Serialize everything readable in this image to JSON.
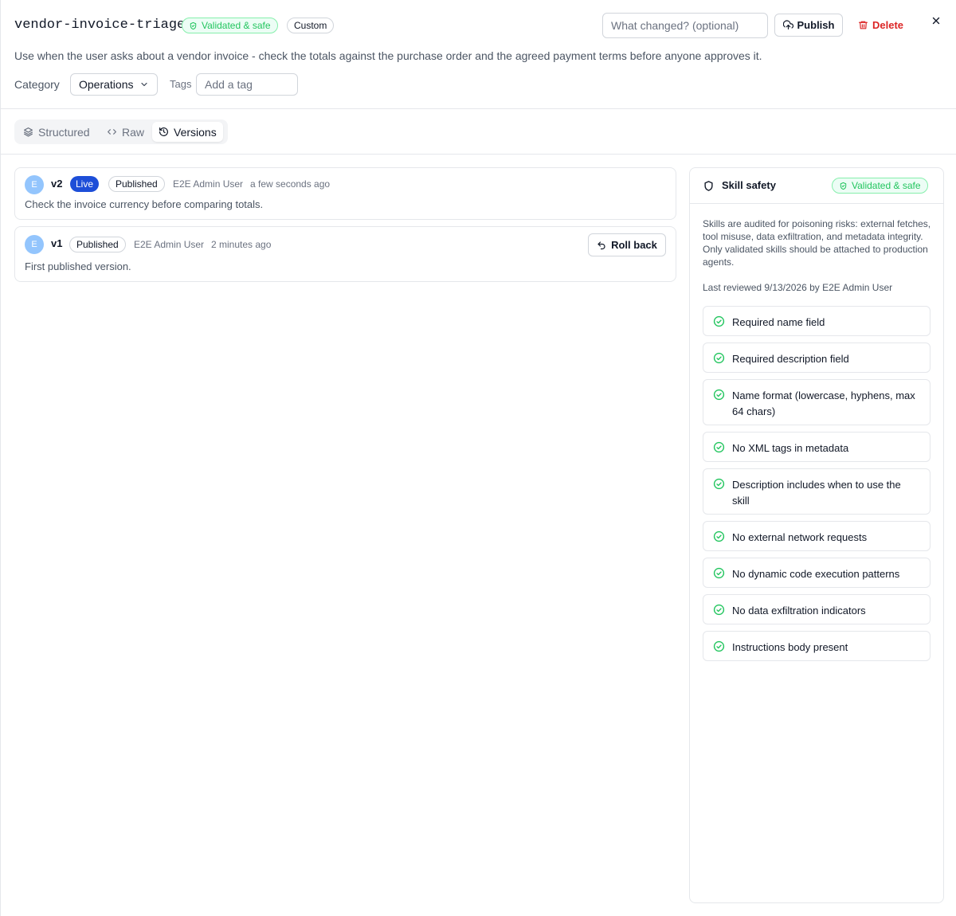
{
  "header": {
    "title": "vendor-invoice-triage",
    "status_badge": "Validated & safe",
    "type_badge": "Custom",
    "change_placeholder": "What changed? (optional)",
    "publish_label": "Publish",
    "delete_label": "Delete",
    "description": "Use when the user asks about a vendor invoice - check the totals against the purchase order and the agreed payment terms before anyone approves it.",
    "category_label": "Category",
    "category_value": "Operations",
    "tags_label": "Tags",
    "tags_placeholder": "Add a tag"
  },
  "tabs": [
    {
      "label": "Structured",
      "icon": "layers-icon"
    },
    {
      "label": "Raw",
      "icon": "code-icon"
    },
    {
      "label": "Versions",
      "icon": "history-icon",
      "active": true
    }
  ],
  "versions": [
    {
      "avatar": "E",
      "version": "v2",
      "live_badge": "Live",
      "status": "Published",
      "author": "E2E Admin User",
      "time": "a few seconds ago",
      "note": "Check the invoice currency before comparing totals."
    },
    {
      "avatar": "E",
      "version": "v1",
      "status": "Published",
      "author": "E2E Admin User",
      "time": "2 minutes ago",
      "note": "First published version.",
      "rollback_label": "Roll back"
    }
  ],
  "safety": {
    "title": "Skill safety",
    "badge": "Validated & safe",
    "description": "Skills are audited for poisoning risks: external fetches, tool misuse, data exfiltration, and metadata integrity. Only validated skills should be attached to production agents.",
    "reviewed": "Last reviewed 9/13/2026 by E2E Admin User",
    "checks": [
      "Required name field",
      "Required description field",
      "Name format (lowercase, hyphens, max 64 chars)",
      "No XML tags in metadata",
      "Description includes when to use the skill",
      "No external network requests",
      "No dynamic code execution patterns",
      "No data exfiltration indicators",
      "Instructions body present"
    ]
  },
  "colors": {
    "accent_blue": "#1d4ed8",
    "safe_green": "#22c55e",
    "danger_red": "#dc2626",
    "avatar_blue": "#93c5fd"
  }
}
